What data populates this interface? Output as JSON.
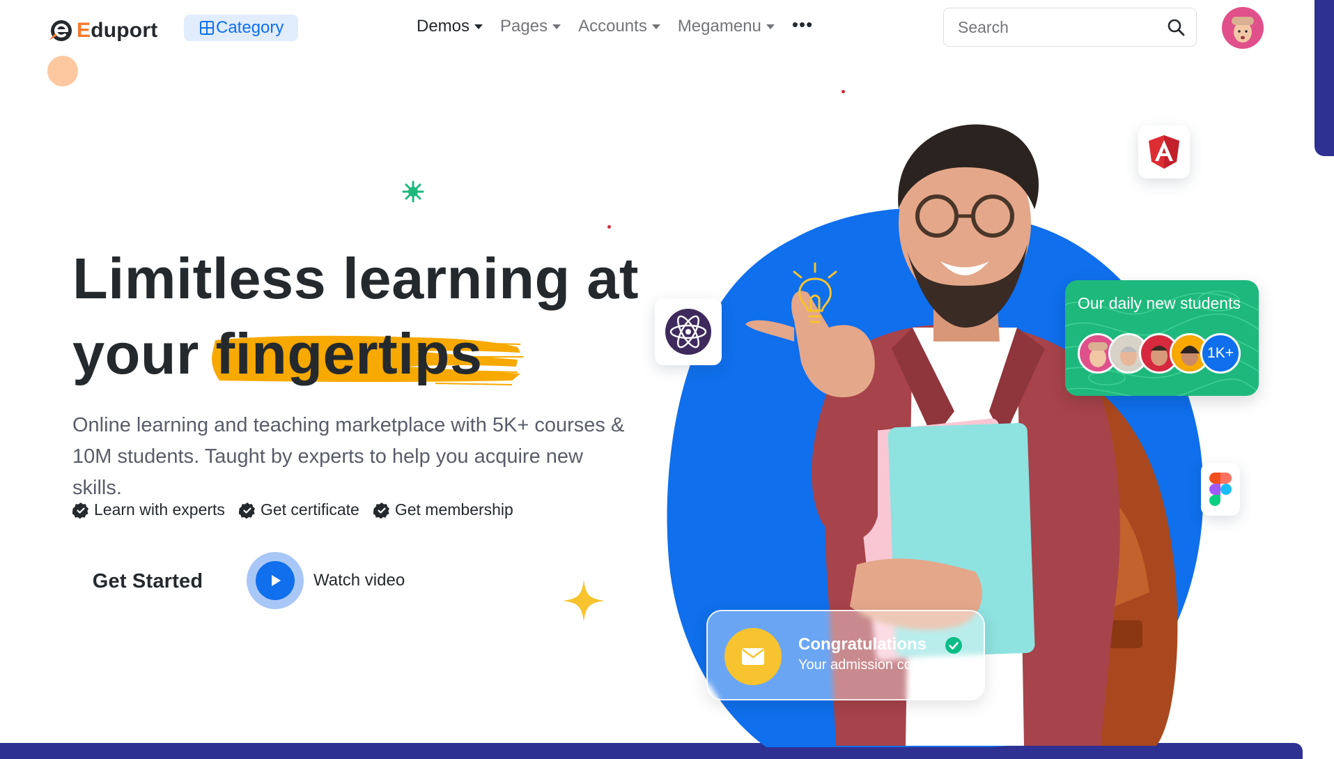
{
  "brand": {
    "name_first": "E",
    "name_rest": "duport"
  },
  "nav": {
    "category_label": "Category",
    "items": [
      {
        "label": "Demos"
      },
      {
        "label": "Pages"
      },
      {
        "label": "Accounts"
      },
      {
        "label": "Megamenu"
      }
    ],
    "more_label": "•••",
    "search_placeholder": "Search"
  },
  "hero": {
    "headline_line1": "Limitless learning at",
    "headline_line2_prefix": "your",
    "headline_highlight": "fingertips",
    "lead": "Online learning and teaching marketplace with 5K+ courses & 10M students. Taught by experts to help you acquire new skills.",
    "features": [
      {
        "label": "Learn with experts"
      },
      {
        "label": "Get certificate"
      },
      {
        "label": "Get membership"
      }
    ],
    "cta_label": "Get Started",
    "video_label": "Watch video"
  },
  "cards": {
    "students_title": "Our daily new students",
    "students_more": "1K+",
    "congrats_title": "Congratulations",
    "congrats_sub": "Your admission completed"
  },
  "colors": {
    "brand_orange": "#f7792b",
    "primary_blue": "#0f6fec",
    "success_green": "#1fb87c",
    "highlight_yellow": "#f7a900",
    "navy": "#2e3192"
  }
}
